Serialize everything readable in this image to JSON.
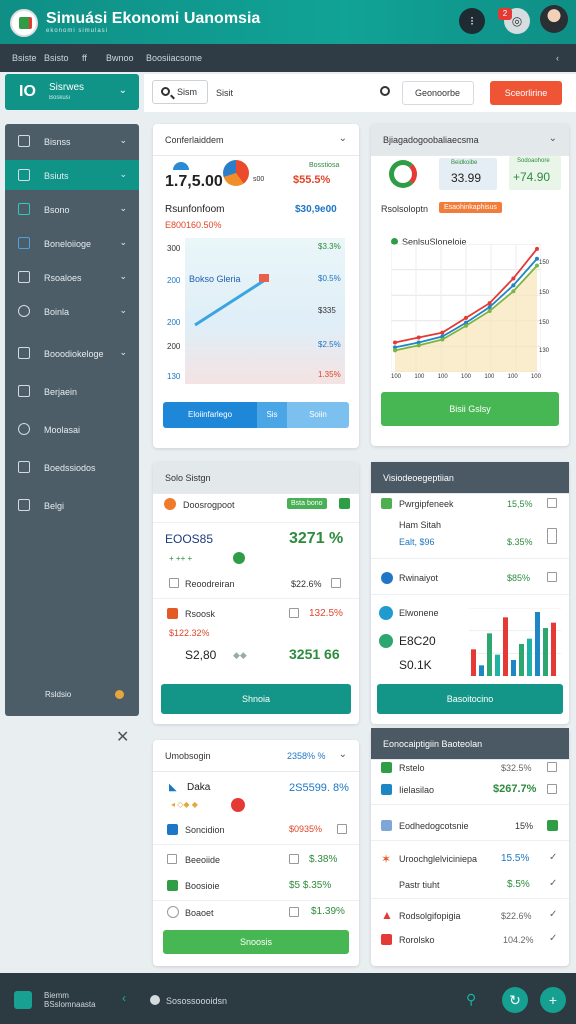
{
  "header": {
    "title": "Simuási Ekonomi Uanomsia",
    "subtitle": "ekonomi simulasi",
    "notif_count": "2"
  },
  "menu": [
    "Bsiste",
    "Bsisto",
    "ff",
    "Bwnoo",
    "Boosiiacsome"
  ],
  "sidebar_head": {
    "icon": "IO",
    "title": "Sisrwes",
    "sub": "Boskusi"
  },
  "search": {
    "placeholder": "Sism",
    "text": "Sisit",
    "dropdown": "Geonoorbe",
    "button": "Sceorlirine"
  },
  "sidebar": {
    "items": [
      {
        "label": "Bisnss"
      },
      {
        "label": "Bsiuts"
      },
      {
        "label": "Bsono"
      },
      {
        "label": "Boneloiioge"
      },
      {
        "label": "Rsoaloes"
      },
      {
        "label": "Boinla"
      },
      {
        "label": "Booodiokeloge"
      },
      {
        "label": "Berjaein"
      },
      {
        "label": "Moolasai"
      },
      {
        "label": "Boedssiodos"
      },
      {
        "label": "Belgi"
      }
    ],
    "footer": "Rsldsio"
  },
  "card1": {
    "title": "Conferlaiddem",
    "big_value": "1.7,5.00",
    "gauge_label": "s00",
    "change_label": "Bosstiosa",
    "change_value": "$55.5%",
    "sub_title": "Rsunfonfoom",
    "sub_value": "$30,9e00",
    "sub_pct": "E800160.50%",
    "chart_label": "Bokso Gleria",
    "y_labels": [
      "300",
      "200",
      "200",
      "200",
      "130"
    ],
    "right_labels": [
      "$3.3%",
      "$0.5%",
      "$335",
      "$2.5%",
      "1.35%"
    ],
    "buttons": [
      "Eloiinfarlego",
      "Sis",
      "Soiin"
    ],
    "chart_data": {
      "type": "line",
      "values": [
        0.15,
        0.3,
        0.45,
        0.6,
        0.75,
        0.9
      ]
    }
  },
  "card2": {
    "title": "Bjiagadogoobaliaecsma",
    "stat1_label": "Beidkoibe",
    "stat1_value": "33.99",
    "stat2_label": "Sodoaohore",
    "stat2_value": "+74.90",
    "section": "Rsolsoloptn",
    "badge": "Esaohinkaphisus",
    "legend": "Senlsu",
    "legend2": "Sloneloie",
    "x_labels": [
      "100",
      "100",
      "100",
      "100",
      "100",
      "100",
      "100"
    ],
    "y_right": [
      "150",
      "150",
      "150",
      "130"
    ],
    "button": "Bisii Gslsy",
    "chart_data": {
      "type": "line",
      "x": [
        "1",
        "2",
        "3",
        "4",
        "5",
        "6",
        "7"
      ],
      "series": [
        {
          "values": [
            30,
            35,
            40,
            55,
            70,
            95,
            125
          ]
        },
        {
          "values": [
            25,
            30,
            36,
            50,
            66,
            88,
            115
          ]
        },
        {
          "values": [
            22,
            27,
            33,
            47,
            62,
            82,
            108
          ]
        }
      ]
    }
  },
  "card3": {
    "title": "Solo Sistgn",
    "row1_label": "Doosrogpoot",
    "row1_badge": "Bsta bono",
    "big_label": "EOOS85",
    "big_value": "3271 %",
    "row2_label": "Reoodreiran",
    "row2_value": "$22.6%",
    "row3_label": "Rsoosk",
    "row3_value": "132.5%",
    "row4_label": "$122.32%",
    "row5_label": "S2,80",
    "row5_value": "3251 66",
    "button": "Shnoia"
  },
  "card4": {
    "title": "Visiodeoegeptiian",
    "rows": [
      {
        "label": "Pwrgipfeneek",
        "value": "15,5%"
      },
      {
        "label": "Ham Sitah",
        "value": ""
      },
      {
        "label": "Ealt, $96",
        "value": "$.35%"
      },
      {
        "label": "Rwinaiyot",
        "value": "$85%"
      },
      {
        "label": "Elwonene",
        "value": ""
      },
      {
        "label": "E8C20",
        "value": ""
      },
      {
        "label": "S0.1K",
        "value": ""
      }
    ],
    "button": "Basoitocino",
    "chart_data": {
      "type": "bar",
      "values": [
        25,
        10,
        40,
        20,
        55,
        15,
        30,
        35,
        60,
        45,
        50
      ]
    }
  },
  "card5": {
    "title": "Umobsogin",
    "row0_value": "2358% %",
    "row0_label": "Daka",
    "row0_pct": "2S5599. 8%",
    "rows": [
      {
        "label": "Soncidion",
        "value": "$0935%"
      },
      {
        "label": "Beeoiide",
        "value": "$.38%"
      },
      {
        "label": "Boosioie",
        "value": "$5 $.35%"
      },
      {
        "label": "Boaoet",
        "value": "$1.39%"
      }
    ],
    "button": "Snoosis"
  },
  "card6": {
    "title": "Eonocaiptigiin Baoteolan",
    "rows": [
      {
        "label": "Rstelo",
        "value": "$32.5%"
      },
      {
        "label": "Iielasilao",
        "value": "$267.7%"
      },
      {
        "label": "Eodhedogcotsnie",
        "value": "15%"
      },
      {
        "label": "Uroochglelviciniepa",
        "value": "15.5%"
      },
      {
        "label": "Pastr tiuht",
        "value": "$.5%"
      },
      {
        "label": "Rodsolgifopigia",
        "value": "$22.6%"
      },
      {
        "label": "Rorolsko",
        "value": "104.2%"
      }
    ]
  },
  "bottom": {
    "title": "Biemm BSslomnaasta",
    "text": "Sosossoooidsn"
  }
}
